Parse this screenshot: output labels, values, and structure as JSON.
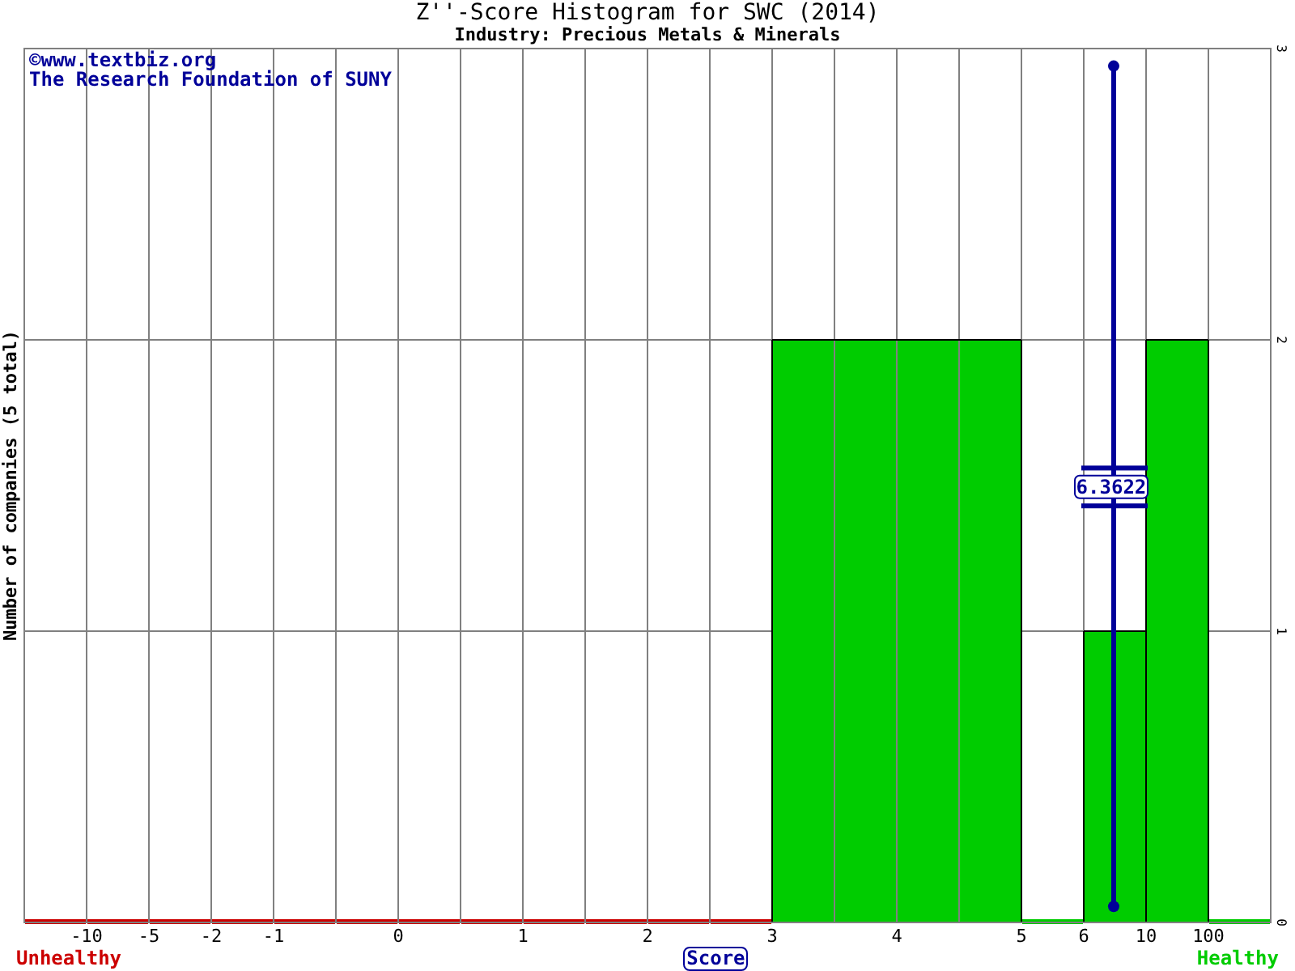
{
  "title": "Z''-Score Histogram for SWC (2014)",
  "subtitle": "Industry: Precious Metals & Minerals",
  "credits": [
    "©www.textbiz.org",
    "The Research Foundation of SUNY"
  ],
  "chart_data": {
    "type": "bar",
    "xlabel": "Score",
    "ylabel": "Number of companies (5 total)",
    "categories": [
      null,
      null,
      null,
      null,
      null,
      null,
      null,
      null,
      null,
      null,
      null,
      null,
      null,
      null,
      null,
      null,
      null,
      null,
      null,
      null
    ],
    "series": [
      {
        "color": "#cc0000",
        "values": [
          0,
          0,
          0,
          0,
          0,
          0,
          0,
          0,
          0,
          0,
          0,
          0,
          null,
          null,
          null,
          null,
          null,
          null,
          null,
          null
        ]
      },
      {
        "color": "#00cc00",
        "values": [
          null,
          null,
          null,
          null,
          null,
          null,
          null,
          null,
          null,
          null,
          null,
          null,
          2,
          2,
          2,
          2,
          0,
          1,
          2,
          0
        ]
      }
    ],
    "grid": true,
    "ylim": [
      0,
      3
    ],
    "yticks": [
      0,
      1,
      2,
      3
    ]
  },
  "x_axis_labels": [
    "-10",
    "-5",
    "-2",
    "-1",
    "0",
    "1",
    "2",
    "3",
    "4",
    "5",
    "6",
    "10",
    "100"
  ],
  "range_marker": {
    "label": "6.3622"
  },
  "zone_labels": [
    {
      "text": "Unhealthy",
      "color": "#cc0000"
    },
    {
      "text": "Healthy",
      "color": "#00cc00"
    }
  ]
}
